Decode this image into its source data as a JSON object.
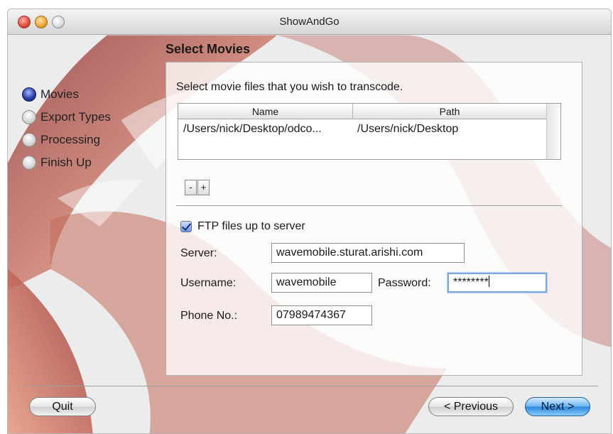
{
  "window": {
    "title": "ShowAndGo"
  },
  "steps": [
    {
      "label": "Movies",
      "active": true
    },
    {
      "label": "Export Types",
      "active": false
    },
    {
      "label": "Processing",
      "active": false
    },
    {
      "label": "Finish Up",
      "active": false
    }
  ],
  "section": {
    "title": "Select Movies",
    "instruction": "Select movie files that you wish to transcode."
  },
  "table": {
    "columns": [
      "Name",
      "Path"
    ],
    "rows": [
      {
        "name": "/Users/nick/Desktop/odco...",
        "path": "/Users/nick/Desktop"
      }
    ]
  },
  "list_buttons": {
    "remove": "-",
    "add": "+"
  },
  "ftp": {
    "checkbox_label": "FTP files up to server",
    "checked": true,
    "server_label": "Server:",
    "server_value": "wavemobile.sturat.arishi.com",
    "username_label": "Username:",
    "username_value": "wavemobile",
    "password_label": "Password:",
    "password_value": "********",
    "phone_label": "Phone No.:",
    "phone_value": "07989474367"
  },
  "buttons": {
    "quit": "Quit",
    "previous": "< Previous",
    "next": "Next >"
  },
  "colors": {
    "accent_blue": "#2b86d8",
    "art_red": "#b5463e",
    "step_active": "#2a3fa8"
  }
}
